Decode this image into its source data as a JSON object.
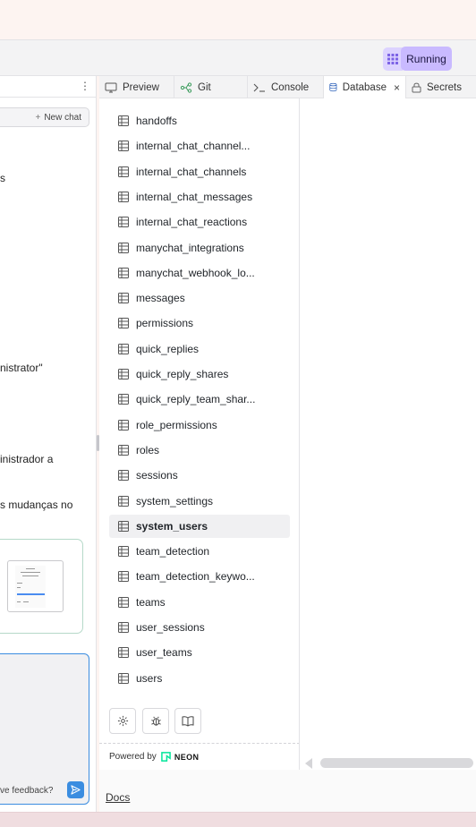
{
  "toolbar": {
    "apps_icon": "grid-icon",
    "running_label": "Running",
    "colors": {
      "running_bg": "#c9baff",
      "grid_bg": "#dcd3ff"
    }
  },
  "left_panel": {
    "new_chat_label": "New chat",
    "fragments": [
      "s",
      "nistrator\"",
      "inistrador a",
      "s mudanças no"
    ],
    "feedback_text": "ve feedback?"
  },
  "tabs": [
    {
      "label": "Preview",
      "icon": "monitor-icon"
    },
    {
      "label": "Git",
      "icon": "git-branch-icon"
    },
    {
      "label": "Console",
      "icon": "terminal-icon"
    },
    {
      "label": "Database",
      "icon": "database-icon",
      "active": true
    },
    {
      "label": "Secrets",
      "icon": "lock-icon"
    }
  ],
  "tables": [
    "handoffs",
    "internal_chat_channel...",
    "internal_chat_channels",
    "internal_chat_messages",
    "internal_chat_reactions",
    "manychat_integrations",
    "manychat_webhook_lo...",
    "messages",
    "permissions",
    "quick_replies",
    "quick_reply_shares",
    "quick_reply_team_shar...",
    "role_permissions",
    "roles",
    "sessions",
    "system_settings",
    "system_users",
    "team_detection",
    "team_detection_keywo...",
    "teams",
    "user_sessions",
    "user_teams",
    "users"
  ],
  "selected_table": "system_users",
  "db_actions": [
    "settings-icon",
    "bug-icon",
    "book-icon"
  ],
  "powered_by": {
    "prefix": "Powered by",
    "brand": "NEON",
    "brand_color": "#00e599"
  },
  "footer": {
    "docs_label": "Docs"
  }
}
